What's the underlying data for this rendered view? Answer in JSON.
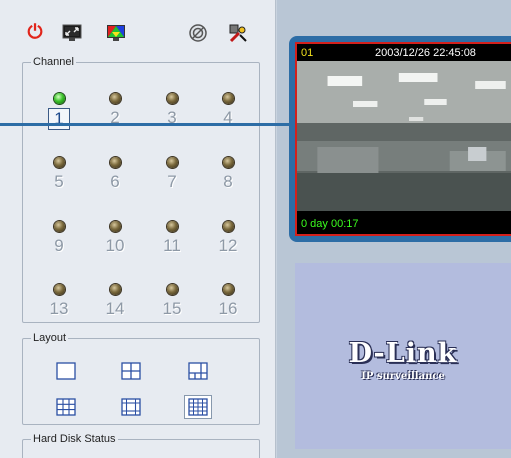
{
  "toolbar": {
    "icons": [
      "power-icon",
      "fullscreen-icon",
      "display-color-icon",
      "record-icon",
      "settings-icon"
    ]
  },
  "channel_group": {
    "legend": "Channel",
    "selected": "1",
    "channels": [
      {
        "label": "1",
        "status": "on"
      },
      {
        "label": "2",
        "status": "off"
      },
      {
        "label": "3",
        "status": "off"
      },
      {
        "label": "4",
        "status": "off"
      },
      {
        "label": "5",
        "status": "off"
      },
      {
        "label": "6",
        "status": "off"
      },
      {
        "label": "7",
        "status": "off"
      },
      {
        "label": "8",
        "status": "off"
      },
      {
        "label": "9",
        "status": "off"
      },
      {
        "label": "10",
        "status": "off"
      },
      {
        "label": "11",
        "status": "off"
      },
      {
        "label": "12",
        "status": "off"
      },
      {
        "label": "13",
        "status": "off"
      },
      {
        "label": "14",
        "status": "off"
      },
      {
        "label": "15",
        "status": "off"
      },
      {
        "label": "16",
        "status": "off"
      }
    ]
  },
  "layout_group": {
    "legend": "Layout",
    "options": [
      "single-layout-icon",
      "quad-layout-icon",
      "six-split-layout-icon",
      "nine-split-layout-icon",
      "ten-split-layout-icon",
      "sixteen-split-layout-icon"
    ],
    "active": "sixteen-split-layout-icon"
  },
  "hdd_group": {
    "legend": "Hard Disk Status"
  },
  "video": {
    "channel_id": "01",
    "timestamp": "2003/12/26 22:45:08",
    "uptime": "0 day  00:17"
  },
  "logo": {
    "brand": "D-Link",
    "tagline": "IP surveillance"
  },
  "colors": {
    "accent": "#2d6da6",
    "video_border": "#d3201c",
    "osd_time": "#ffffff",
    "osd_uptime": "#3bff1e",
    "osd_channel": "#f4e21d"
  }
}
